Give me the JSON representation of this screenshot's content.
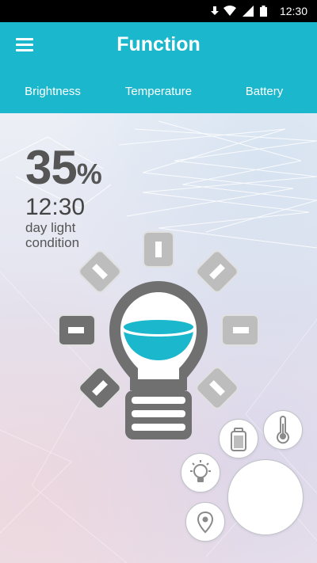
{
  "status_bar": {
    "time": "12:30",
    "icons": [
      "download-arrow-icon",
      "wifi-icon",
      "signal-icon",
      "battery-icon"
    ]
  },
  "app_bar": {
    "title": "Function",
    "menu_icon": "hamburger-menu-icon"
  },
  "tabs": [
    {
      "label": "Brightness",
      "selected": true
    },
    {
      "label": "Temperature",
      "selected": false
    },
    {
      "label": "Battery",
      "selected": false
    }
  ],
  "reading": {
    "value": "35",
    "unit": "%",
    "time": "12:30",
    "condition": "day light condition"
  },
  "bulb": {
    "icon": "light-bulb-icon",
    "fill_color": "#1bb7cc"
  },
  "fab_menu": [
    {
      "icon": "battery-icon"
    },
    {
      "icon": "thermometer-icon"
    },
    {
      "icon": "light-bulb-icon"
    },
    {
      "icon": "location-pin-icon"
    },
    {
      "icon": "main-action-button"
    }
  ],
  "colors": {
    "accent": "#1bb7cc",
    "tab_indicator": "#e7f07a",
    "bulb_dark": "#707070",
    "bulb_light": "#bdbdbd"
  }
}
